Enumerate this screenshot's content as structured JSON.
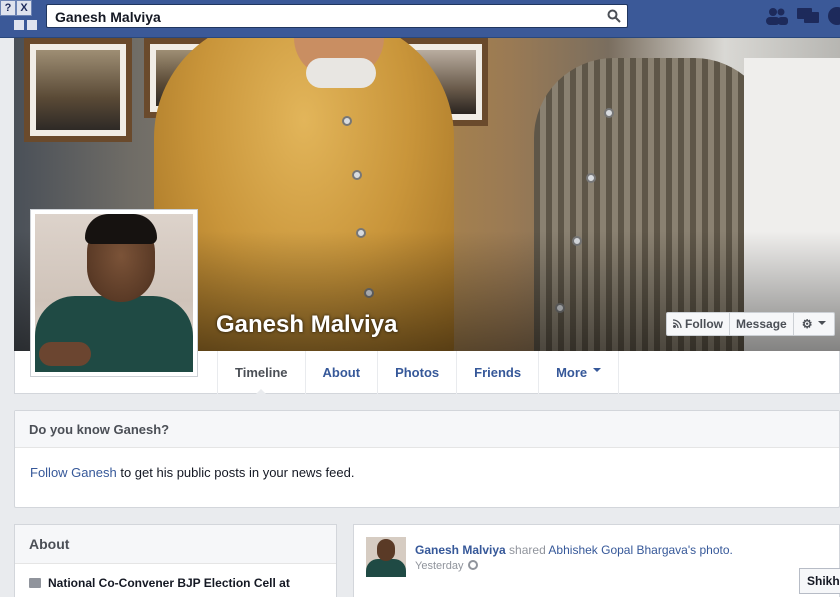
{
  "window": {
    "help_glyph": "?",
    "close_glyph": "X"
  },
  "search": {
    "value": "Ganesh Malviya",
    "icon": "magnifier"
  },
  "jewels": [
    "friend-requests-icon",
    "messages-icon",
    "notifications-icon"
  ],
  "profile": {
    "name": "Ganesh Malviya"
  },
  "actions": {
    "follow": "Follow",
    "message": "Message",
    "settings_icon": "gear"
  },
  "tabs": [
    "Timeline",
    "About",
    "Photos",
    "Friends",
    "More"
  ],
  "know_card": {
    "title": "Do you know Ganesh?",
    "link": "Follow Ganesh",
    "text": " to get his public posts in your news feed."
  },
  "about": {
    "title": "About",
    "item": "National Co-Convener BJP Election Cell at"
  },
  "post": {
    "author": "Ganesh Malviya",
    "verb": " shared ",
    "target": "Abhishek Gopal Bhargava's photo.",
    "time": "Yesterday"
  },
  "chat": {
    "label": "Shikha"
  },
  "colors": {
    "brand": "#3b5998",
    "link": "#365899",
    "background": "#e9ebee"
  }
}
